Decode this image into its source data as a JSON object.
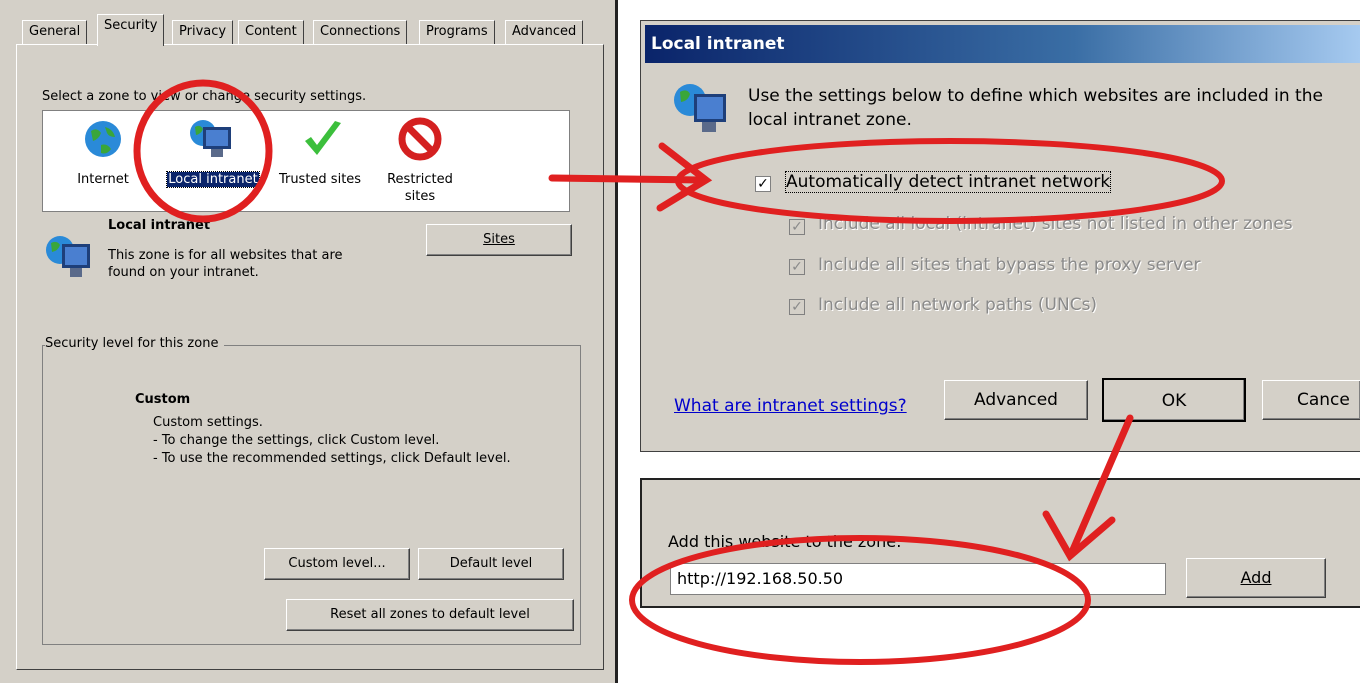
{
  "left": {
    "tabs": [
      "General",
      "Security",
      "Privacy",
      "Content",
      "Connections",
      "Programs",
      "Advanced"
    ],
    "select_zone_text": "Select a zone to view or change security settings.",
    "zones": [
      {
        "label": "Internet",
        "icon": "globe-icon"
      },
      {
        "label": "Local intranet",
        "icon": "computer-globe-icon"
      },
      {
        "label": "Trusted sites",
        "icon": "checkmark-icon"
      },
      {
        "label": "Restricted sites",
        "icon": "no-entry-icon"
      }
    ],
    "zone_title": "Local intranet",
    "zone_desc": "This zone is for all websites that are found on your intranet.",
    "sites_button": "Sites",
    "security_level_legend": "Security level for this zone",
    "level_name": "Custom",
    "level_lines": [
      "Custom settings.",
      "- To change the settings, click Custom level.",
      "- To use the recommended settings, click Default level."
    ],
    "custom_level_button": "Custom level...",
    "default_level_button": "Default level",
    "reset_button": "Reset all zones to default level"
  },
  "dialog": {
    "title": "Local intranet",
    "intro": "Use the settings below to define which websites are included in the local intranet zone.",
    "auto_detect": {
      "label": "Automatically detect intranet network",
      "checked": true
    },
    "options": [
      {
        "label": "Include all local (intranet) sites not listed in other zones",
        "checked": true,
        "enabled": false
      },
      {
        "label": "Include all sites that bypass the proxy server",
        "checked": true,
        "enabled": false
      },
      {
        "label": "Include all network paths (UNCs)",
        "checked": true,
        "enabled": false
      }
    ],
    "help_link": "What are intranet settings?",
    "advanced_button": "Advanced",
    "ok_button": "OK",
    "cancel_button": "Cance"
  },
  "addsite": {
    "label": "Add this website to the zone:",
    "url_value": "http://192.168.50.50",
    "add_button": "Add"
  },
  "colors": {
    "annotation_red": "#e02020",
    "dialog_bg": "#d4d0c8",
    "title_blue": "#0a246a",
    "link_blue": "#0000cc"
  }
}
